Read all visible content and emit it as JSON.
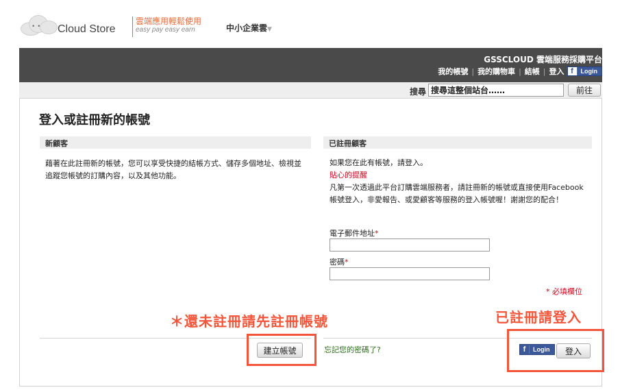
{
  "brand": {
    "logo_text": "Cloud Store",
    "slogan_zh": "雲端應用輕鬆使用",
    "slogan_en": "easy pay easy earn",
    "sme_menu": "中小企業雲"
  },
  "header": {
    "platform_title": "GSSCLOUD 雲端服務採購平台",
    "links": [
      "我的帳號",
      "我的購物車",
      "結帳",
      "登入"
    ],
    "facebook_login": "Login"
  },
  "search": {
    "label": "搜尋",
    "value": "搜尋這整個站台……",
    "button": "前往"
  },
  "page": {
    "title": "登入或註冊新的帳號"
  },
  "new_customer": {
    "heading": "新顧客",
    "description": "藉著在此註冊新的帳號，您可以享受快捷的結帳方式、儲存多個地址、檢視並追蹤您帳號的訂購內容，以及其他功能。",
    "create_button": "建立帳號"
  },
  "registered_customer": {
    "heading": "已註冊顧客",
    "intro": "如果您在此有帳號，請登入。",
    "hint_title": "貼心的提醒",
    "hint_text": "凡第一次透過此平台訂購雲端服務者，請註冊新的帳號或直接使用Facebook 帳號登入，非愛報告、或愛顧客等服務的登入帳號喔！謝謝您的配合！",
    "email_label": "電子郵件地址",
    "password_label": "密碼",
    "required_mark": "*",
    "required_note": "* 必填欄位",
    "forgot_link": "忘記您的密碼了?",
    "facebook_login": "Login",
    "login_button": "登入"
  },
  "annotations": {
    "left": "＊還未註冊請先註冊帳號",
    "right": "已註冊請登入",
    "color": "#f2553a"
  },
  "colors": {
    "navbar": "#4a4a4a",
    "facebook": "#3b5998",
    "required": "#d0021b",
    "link_green": "#2e6e1e"
  }
}
